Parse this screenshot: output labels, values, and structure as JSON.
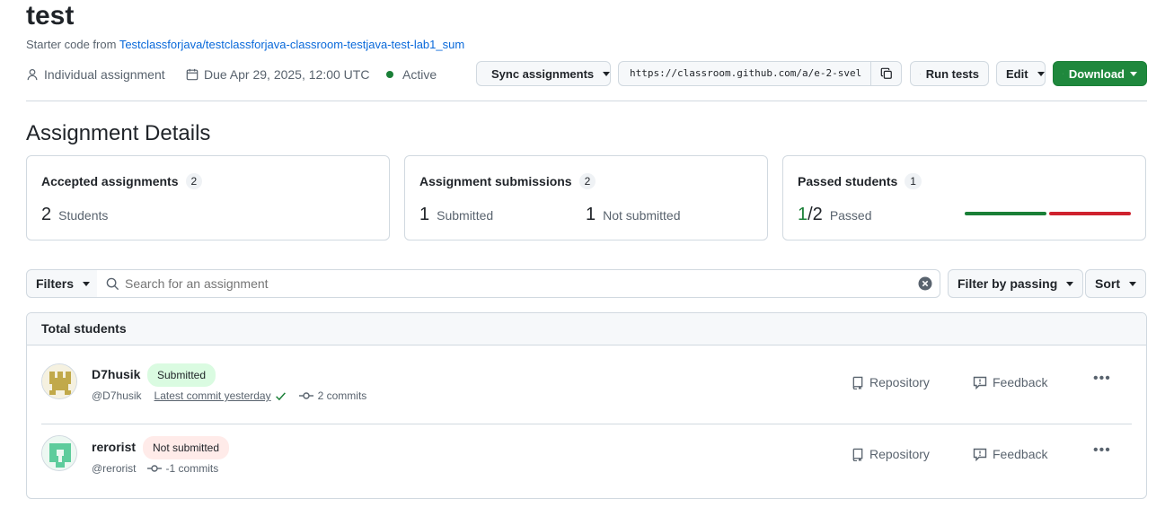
{
  "page": {
    "title": "test",
    "starter_prefix": "Starter code from",
    "starter_link": "Testclassforjava/testclassforjava-classroom-testjava-test-lab1_sum"
  },
  "meta": {
    "type": "Individual assignment",
    "due": "Due Apr 29, 2025, 12:00 UTC",
    "status": "Active"
  },
  "toolbar": {
    "sync_label": "Sync assignments",
    "invite_url": "https://classroom.github.com/a/e-2-svel",
    "run_tests_label": "Run tests",
    "edit_label": "Edit",
    "download_label": "Download"
  },
  "details": {
    "heading": "Assignment Details",
    "accepted": {
      "title": "Accepted assignments",
      "count": "2",
      "num": "2",
      "label": "Students"
    },
    "submissions": {
      "title": "Assignment submissions",
      "count": "2",
      "submitted_num": "1",
      "submitted_label": "Submitted",
      "not_submitted_num": "1",
      "not_submitted_label": "Not submitted"
    },
    "passed": {
      "title": "Passed students",
      "count": "1",
      "passed_num": "1",
      "total": "/2",
      "label": "Passed",
      "fraction": 0.5
    }
  },
  "filters": {
    "filters_label": "Filters",
    "search_placeholder": "Search for an assignment",
    "filter_passing_label": "Filter by passing",
    "sort_label": "Sort"
  },
  "list": {
    "header": "Total students",
    "rows": [
      {
        "name": "D7husik",
        "status": "Submitted",
        "handle": "@D7husik",
        "commit": "Latest commit yesterday",
        "commits": "2 commits",
        "repo_label": "Repository",
        "feedback_label": "Feedback"
      },
      {
        "name": "rerorist",
        "status": "Not submitted",
        "handle": "@rerorist",
        "commits": "-1 commits",
        "repo_label": "Repository",
        "feedback_label": "Feedback"
      }
    ]
  },
  "colors": {
    "accent": "#0969da",
    "green": "#1f883d",
    "red": "#cf222e"
  }
}
